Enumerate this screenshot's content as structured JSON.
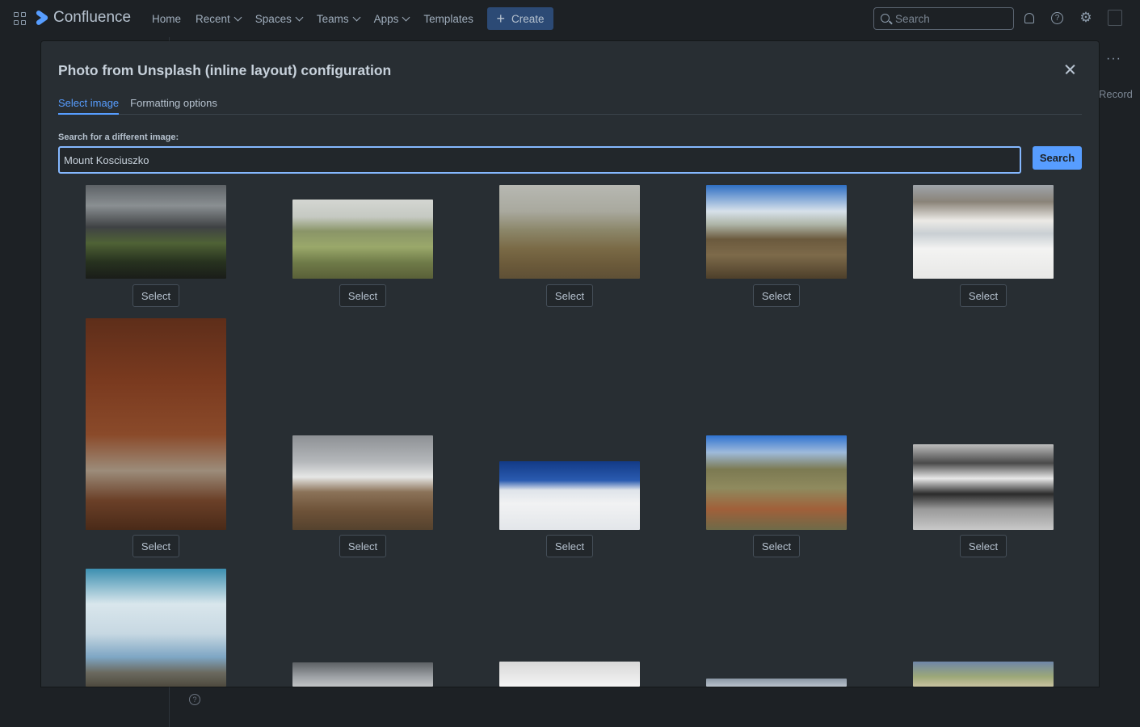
{
  "topnav": {
    "logo": "Confluence",
    "items": [
      {
        "label": "Home",
        "dropdown": false
      },
      {
        "label": "Recent",
        "dropdown": true
      },
      {
        "label": "Spaces",
        "dropdown": true
      },
      {
        "label": "Teams",
        "dropdown": true
      },
      {
        "label": "Apps",
        "dropdown": true
      },
      {
        "label": "Templates",
        "dropdown": false
      }
    ],
    "create_label": "Create",
    "search_placeholder": "Search"
  },
  "background": {
    "record_label": "Record",
    "more_label": "···"
  },
  "modal": {
    "title": "Photo from Unsplash (inline layout) configuration",
    "tabs": [
      {
        "label": "Select image",
        "active": true
      },
      {
        "label": "Formatting options",
        "active": false
      }
    ],
    "search_label": "Search for a different image:",
    "search_value": "Mount Kosciuszko",
    "search_button": "Search",
    "select_label": "Select"
  },
  "colors": {
    "accent": "#579dff",
    "modal_bg": "#282e33",
    "page_bg": "#1d2125"
  }
}
